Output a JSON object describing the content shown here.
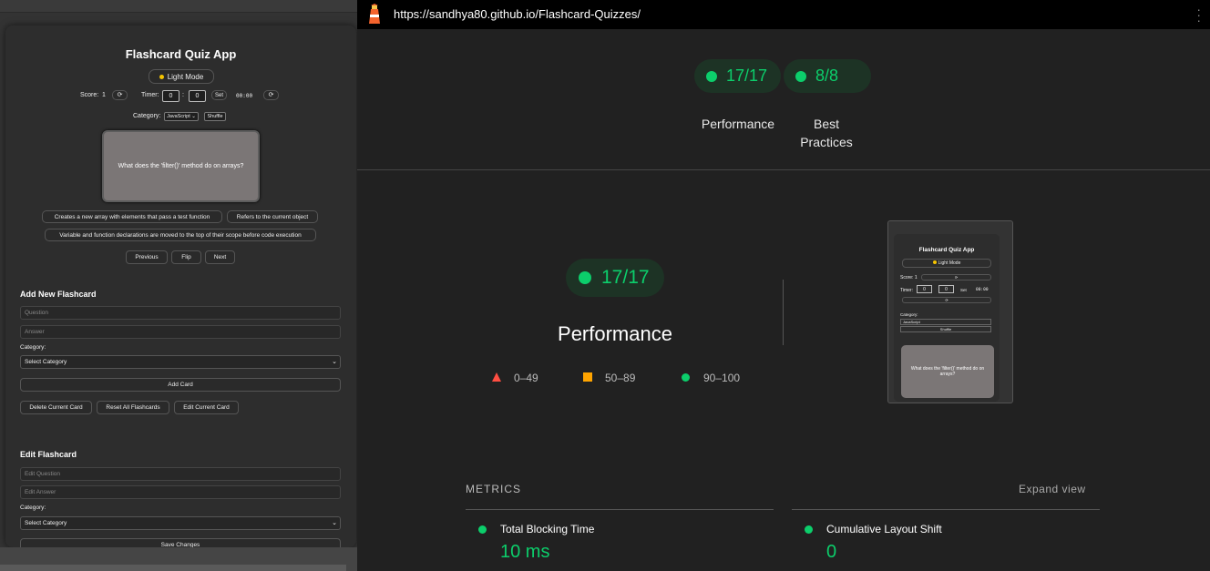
{
  "left_app": {
    "title": "Flashcard Quiz App",
    "mode_button": "Light Mode",
    "score_label": "Score:",
    "score_value": "1",
    "reset_glyph": "⟳",
    "timer_label": "Timer:",
    "timer_min": "0",
    "timer_colon": ":",
    "timer_sec": "0",
    "timer_set": "Set",
    "timer_display": "00:00",
    "category_label": "Category:",
    "category_value": "JavaScript",
    "shuffle": "Shuffle",
    "card_question": "What does the 'filter()' method do on arrays?",
    "answers": [
      "Creates a new array with elements that pass a test function",
      "Refers to the current object",
      "Variable and function declarations are moved to the top of their scope before code execution"
    ],
    "nav": {
      "previous": "Previous",
      "flip": "Flip",
      "next": "Next"
    },
    "add_section": {
      "heading": "Add New Flashcard",
      "question_placeholder": "Question",
      "answer_placeholder": "Answer",
      "category_label": "Category:",
      "category_select": "Select Category",
      "add_button": "Add Card"
    },
    "actions": {
      "delete": "Delete Current Card",
      "reset": "Reset All Flashcards",
      "edit": "Edit Current Card"
    },
    "edit_section": {
      "heading": "Edit Flashcard",
      "question_placeholder": "Edit Question",
      "answer_placeholder": "Edit Answer",
      "category_label": "Category:",
      "category_select": "Select Category",
      "save_button": "Save Changes"
    }
  },
  "lighthouse": {
    "url": "https://sandhya80.github.io/Flashcard-Quizzes/",
    "top_gauges": [
      {
        "value": "17/17",
        "label": "Performance"
      },
      {
        "value": "8/8",
        "label_line1": "Best",
        "label_line2": "Practices"
      }
    ],
    "main_gauge": "17/17",
    "main_title": "Performance",
    "legend": [
      "0–49",
      "50–89",
      "90–100"
    ],
    "colors": {
      "pass": "#0cce6b",
      "average": "#ffa400",
      "fail": "#ff4e42"
    },
    "thumbnail": {
      "title": "Flashcard Quiz App",
      "mode": "Light Mode",
      "score": "Score: 1",
      "timer": "Timer:",
      "timer_min": "0",
      "timer_sec": "0",
      "set": "Set",
      "clock": "00:00",
      "reset": "⟳",
      "category": "Category:",
      "category_value": "JavaScript",
      "shuffle": "Shuffle",
      "card": "What does the 'filter()' method do on arrays?"
    },
    "metrics_header": "METRICS",
    "expand": "Expand view",
    "metrics": [
      {
        "name": "Total Blocking Time",
        "value": "10 ms"
      },
      {
        "name": "Cumulative Layout Shift",
        "value": "0"
      }
    ]
  }
}
